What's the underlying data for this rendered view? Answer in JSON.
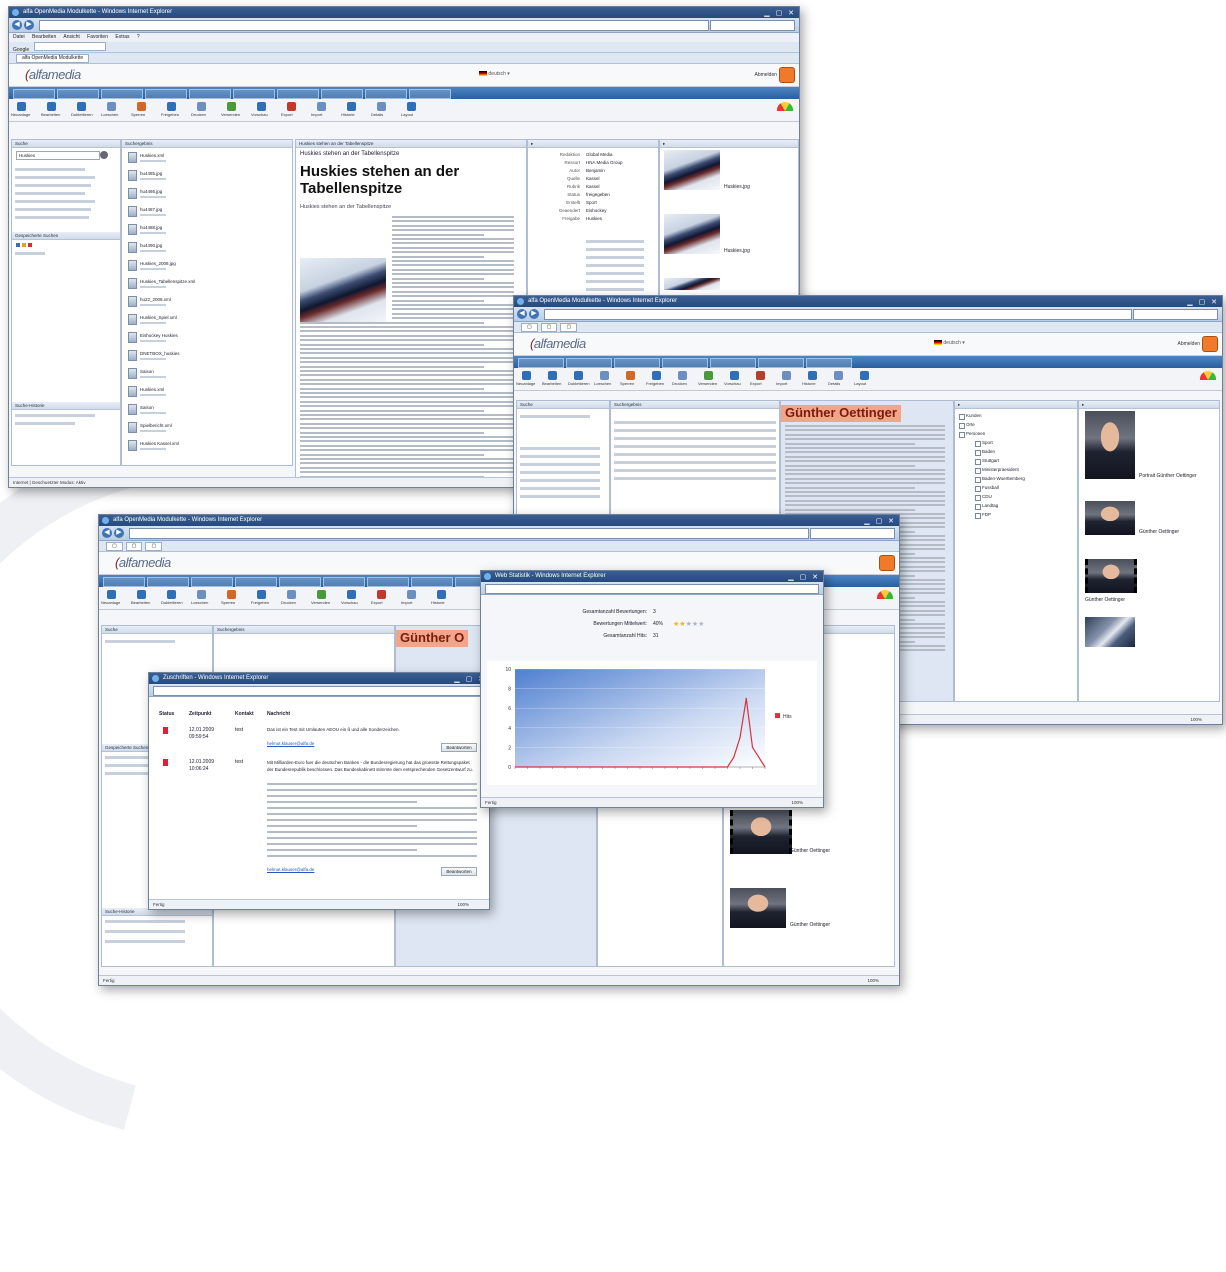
{
  "brand": {
    "accent": "#2a5f9e",
    "highlight": "#f3a58c",
    "logo_text": "alfamedia"
  },
  "win1": {
    "title": "alfa OpenMedia Modulkette - Windows Internet Explorer",
    "search": "Google",
    "menu": "Datei  Bearbeiten  Ansicht  Favoriten  Extras  ?",
    "favtab": "alfa OpenMedia Modulkette",
    "language_label": "deutsch",
    "logout": "Abmelden",
    "tabs": [
      "Archiv",
      "Suche",
      "Bilder",
      "Texte",
      "Web",
      "Print",
      "Mobil",
      "Import",
      "Export",
      "Admin"
    ],
    "toolbar": [
      "Neuanlage",
      "Bearbeiten",
      "Dublettieren",
      "Loeschen",
      "Sperren",
      "Freigeben",
      "Drucken",
      "Versenden",
      "Vorschau",
      "Export",
      "Import",
      "Historie",
      "Details",
      "Layout"
    ],
    "left_headers": [
      "Suche",
      "Archiv",
      "Gespeicherte Suchen",
      "Suche-Historie"
    ],
    "search_value": "Huskies",
    "files_header": "Suchergebnis",
    "files": [
      "Huskies.xml",
      "hu4485.jpg",
      "hu4486.jpg",
      "hu4487.jpg",
      "hu4488.jpg",
      "hu4490.jpg",
      "Huskies_2008.jpg",
      "Huskies_Tabellenspitze.xml",
      "hu22_2008.xml",
      "Huskies_Spiel.xml",
      "Eishockey Huskies",
      "DNETBOX_huskies",
      "Saison",
      "Huskies.xml",
      "Saison",
      "Spielbericht.xml",
      "Huskies Kassel.xml"
    ],
    "article_header": "Huskies stehen an der Tabellenspitze",
    "article_title": "Huskies stehen an der Tabellenspitze",
    "article_subtitle": "Huskies stehen an der Tabellenspitze",
    "meta_labels": [
      "Redaktion",
      "Ressort",
      "Autor",
      "Quelle",
      "Rubrik",
      "Status",
      "Erstellt",
      "Geaendert",
      "Freigabe"
    ],
    "meta_values": [
      "Global Media",
      "HNA Media Group",
      "Benjamin",
      "Kassel",
      "Kassel",
      "freigegeben",
      "Sport",
      "Eishockey",
      "Huskies"
    ],
    "thumb_labels": [
      "Huskies.jpg",
      "Huskies.jpg",
      "Huskies.jpg"
    ],
    "status": "Internet | Geschuetzter Modus: Aktiv"
  },
  "win2": {
    "title": "alfa OpenMedia Modulkette - Windows Internet Explorer",
    "heading": "Günther Oettinger",
    "tabs": [
      "Archiv",
      "Suche",
      "Bilder",
      "Texte",
      "Web",
      "Print",
      "Mobil"
    ],
    "caption_1": "Portrait Günther Oettinger",
    "caption_2": "Günther Oettinger",
    "caption_3": "Günther Oettinger",
    "tree": [
      "Kunden",
      "Orte",
      "Personen",
      "Sport",
      "Baden",
      "Stuttgart",
      "Ministerpraesident",
      "Baden-Wuerttemberg",
      "Fussball",
      "CDU",
      "Landtag",
      "FDP"
    ],
    "status": "Internet | Geschuetzter Modus: Aktiv",
    "zoom": "100%"
  },
  "win3": {
    "title": "alfa OpenMedia Modulkette - Windows Internet Explorer",
    "heading": "Günther O",
    "status": "Fertig",
    "zoom": "100%",
    "captions": [
      "Günther Oettinger",
      "Oettinger",
      "Günther Oettinger"
    ]
  },
  "dialog_msgs": {
    "title": "Zuschriften - Windows Internet Explorer",
    "headers": [
      "Status",
      "Zeitpunkt",
      "Kontakt",
      "Nachricht"
    ],
    "rows": [
      {
        "date": "12.01.2009",
        "time": "09:59:54",
        "contact": "test",
        "text": "Das ist ein Test mit Umlauten AEOU ein ß und alle Sonderzeichen.",
        "button": "Beantworten",
        "link": "helmut.klauser@alfa.de"
      },
      {
        "date": "12.01.2009",
        "time": "10:06:24",
        "contact": "test",
        "text": "Mit Milliarden-Euro fuer die deutschen Banken - die Bundesregierung hat das groesste Rettungspaket der Bundesrepublik beschlossen. Das Bundeskabinett stimmte dem entsprechenden Gesetzentwurf zu.",
        "button": "Beantworten",
        "link": "helmut.klauser@alfa.de"
      }
    ],
    "status": "Fertig",
    "zoom": "100%"
  },
  "dialog_stats": {
    "title": "Web Statistik - Windows Internet Explorer",
    "rows": [
      {
        "label": "Gesamtanzahl Bewertungen:",
        "value": "3"
      },
      {
        "label": "Bewertungen Mittelwert:",
        "value": "40%"
      },
      {
        "label": "Gesamtanzahl Hits:",
        "value": "31"
      }
    ],
    "rating_stars": 2,
    "rating_max": 5,
    "status": "Fertig",
    "zoom": "100%"
  },
  "chart_data": {
    "type": "area",
    "title": "",
    "xlabel": "",
    "ylabel": "",
    "ylim": [
      0,
      10
    ],
    "yticks": [
      0,
      2,
      4,
      6,
      8,
      10
    ],
    "x": [
      0,
      1,
      2,
      3,
      4,
      5,
      6,
      7,
      8,
      9,
      10,
      11,
      12,
      13,
      14,
      15,
      16,
      17,
      18,
      19,
      20,
      21,
      22,
      23,
      24,
      25,
      26,
      27,
      28,
      29,
      30,
      31,
      32,
      33,
      34,
      35,
      36,
      37,
      38,
      39,
      40
    ],
    "series": [
      {
        "name": "Hits",
        "color": "#d8343a",
        "values": [
          0,
          0,
          0,
          0,
          0,
          0,
          0,
          0,
          0,
          0,
          0,
          0,
          0,
          0,
          0,
          0,
          0,
          0,
          0,
          0,
          0,
          0,
          0,
          0,
          0,
          0,
          0,
          0,
          0,
          0,
          0,
          0,
          0,
          0,
          0,
          1,
          3,
          7,
          2,
          1,
          0
        ]
      }
    ],
    "legend": "right"
  }
}
